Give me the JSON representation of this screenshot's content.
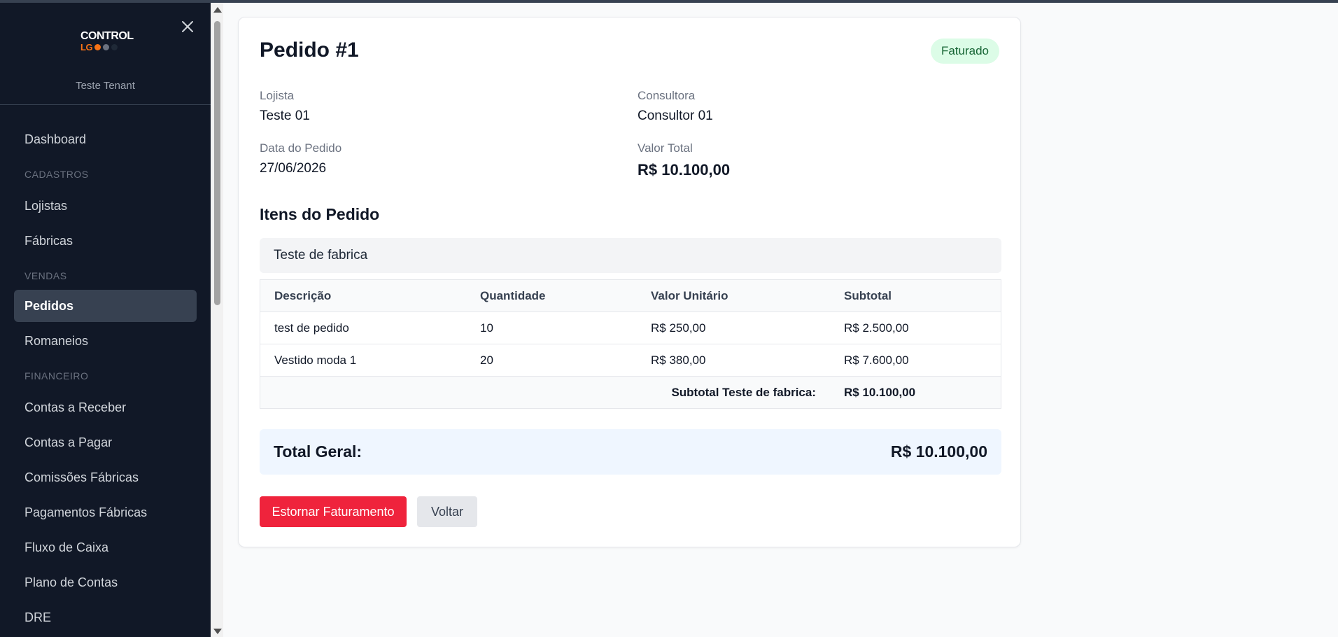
{
  "colors": {
    "sidebar_bg": "#111827",
    "accent_orange": "#f97316",
    "danger": "#ef233c",
    "success_badge_bg": "#dcfce7",
    "success_badge_text": "#166534"
  },
  "sidebar": {
    "logo_top": "CONTROL",
    "logo_bottom": "LG",
    "tenant": "Teste Tenant",
    "close_icon": "close-icon",
    "sections": {
      "cadastros": "CADASTROS",
      "vendas": "VENDAS",
      "financeiro": "FINANCEIRO"
    },
    "items": {
      "dashboard": "Dashboard",
      "lojistas": "Lojistas",
      "fabricas": "Fábricas",
      "pedidos": "Pedidos",
      "romaneios": "Romaneios",
      "contas_receber": "Contas a Receber",
      "contas_pagar": "Contas a Pagar",
      "comissoes": "Comissões Fábricas",
      "pagamentos": "Pagamentos Fábricas",
      "fluxo": "Fluxo de Caixa",
      "plano": "Plano de Contas",
      "dre": "DRE"
    }
  },
  "order": {
    "title": "Pedido #1",
    "status": "Faturado",
    "lojista_label": "Lojista",
    "lojista": "Teste 01",
    "consultora_label": "Consultora",
    "consultora": "Consultor 01",
    "data_label": "Data do Pedido",
    "data": "27/06/2026",
    "valor_label": "Valor Total",
    "valor": "R$ 10.100,00"
  },
  "items_section": {
    "title": "Itens do Pedido",
    "factory": "Teste de fabrica",
    "headers": {
      "descricao": "Descrição",
      "quantidade": "Quantidade",
      "valor_unitario": "Valor Unitário",
      "subtotal": "Subtotal"
    },
    "rows": [
      {
        "descricao": "test de pedido",
        "quantidade": "10",
        "valor_unitario": "R$ 250,00",
        "subtotal": "R$ 2.500,00"
      },
      {
        "descricao": "Vestido moda 1",
        "quantidade": "20",
        "valor_unitario": "R$ 380,00",
        "subtotal": "R$ 7.600,00"
      }
    ],
    "subtotal_label": "Subtotal Teste de fabrica:",
    "subtotal_value": "R$ 10.100,00"
  },
  "total": {
    "label": "Total Geral:",
    "value": "R$ 10.100,00"
  },
  "actions": {
    "estornar": "Estornar Faturamento",
    "voltar": "Voltar"
  }
}
